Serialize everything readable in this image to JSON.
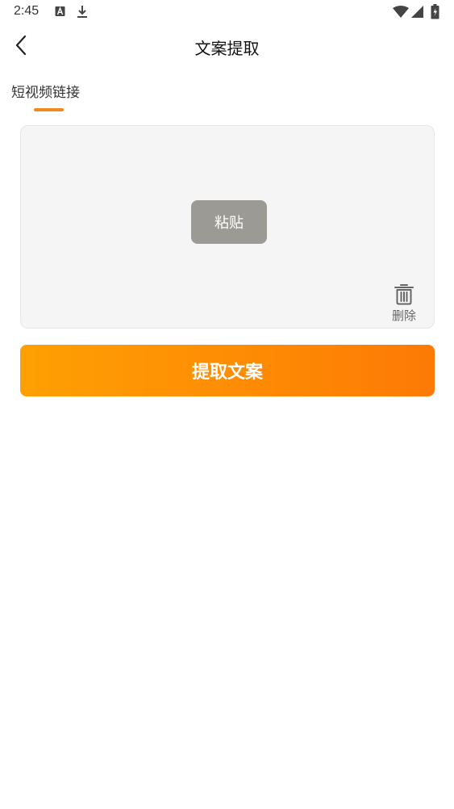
{
  "status_bar": {
    "time": "2:45",
    "icons": [
      "keyboard-a-icon",
      "download-icon",
      "wifi-icon",
      "signal-icon",
      "battery-charging-icon"
    ]
  },
  "header": {
    "title": "文案提取",
    "back_icon": "chevron-left-icon"
  },
  "tab": {
    "label": "短视频链接",
    "accent_color": "#f08a1c"
  },
  "input_panel": {
    "paste_label": "粘贴",
    "delete_label": "删除",
    "delete_icon": "trash-icon"
  },
  "actions": {
    "extract_label": "提取文案",
    "gradient_start": "#fea003",
    "gradient_end": "#fd7a05"
  }
}
